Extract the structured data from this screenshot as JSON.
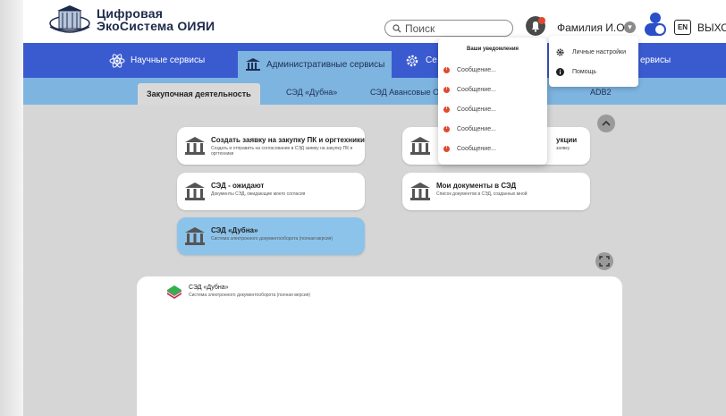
{
  "brand": {
    "line1": "Цифровая",
    "line2": "ЭкоСистема ОИЯИ"
  },
  "header": {
    "search_placeholder": "Поиск",
    "username": "Фамилия И.О.",
    "lang": "EN",
    "logout": "ВЫХОД"
  },
  "nav1": {
    "items": [
      {
        "label": "Научные сервисы",
        "icon": "atom-icon"
      },
      {
        "label": "Административные сервисы",
        "icon": "building-icon"
      },
      {
        "label": "Се",
        "icon": "gear-icon"
      },
      {
        "label": "ервисы",
        "icon": ""
      }
    ]
  },
  "nav2": {
    "items": [
      {
        "label": "Закупочная деятельность"
      },
      {
        "label": "СЭД «Дубна»"
      },
      {
        "label": "СЭД Авансовые От"
      },
      {
        "label": "ADB2"
      }
    ]
  },
  "cards": [
    {
      "title": "Создать заявку на закупку ПК и оргтехники",
      "desc": "Создать и отправить на согласование в СЭД заявку на закупку ПК и оргтехники"
    },
    {
      "title": "СЭД - ожидают",
      "desc": "Документы СЭД, ожидающие моего согласия"
    },
    {
      "title": "СЭД «Дубна»",
      "desc": "Система электронного документооборота (полная версия)"
    },
    {
      "title": "укции",
      "desc": "заявку"
    },
    {
      "title": "Мои документы в СЭД",
      "desc": "Список документов в СЭД, созданных мной"
    }
  ],
  "panel": {
    "title": "СЭД «Дубна»",
    "desc": "Система электронного документооборота (полная версия)"
  },
  "notifications": {
    "title": "Ваши уведомления",
    "items": [
      "Сообщение...",
      "Сообщение...",
      "Сообщение...",
      "Сообщение...",
      "Сообщение..."
    ]
  },
  "user_menu": {
    "items": [
      {
        "label": "Личные настройки",
        "icon": "gear-icon"
      },
      {
        "label": "Помощь",
        "icon": "info-icon"
      }
    ]
  },
  "colors": {
    "nav_primary": "#3a5bd0",
    "nav_secondary": "#7db4e0",
    "content_bg": "#d6d6d6",
    "selected_card": "#8cc3ea",
    "alert": "#e04a2c"
  }
}
